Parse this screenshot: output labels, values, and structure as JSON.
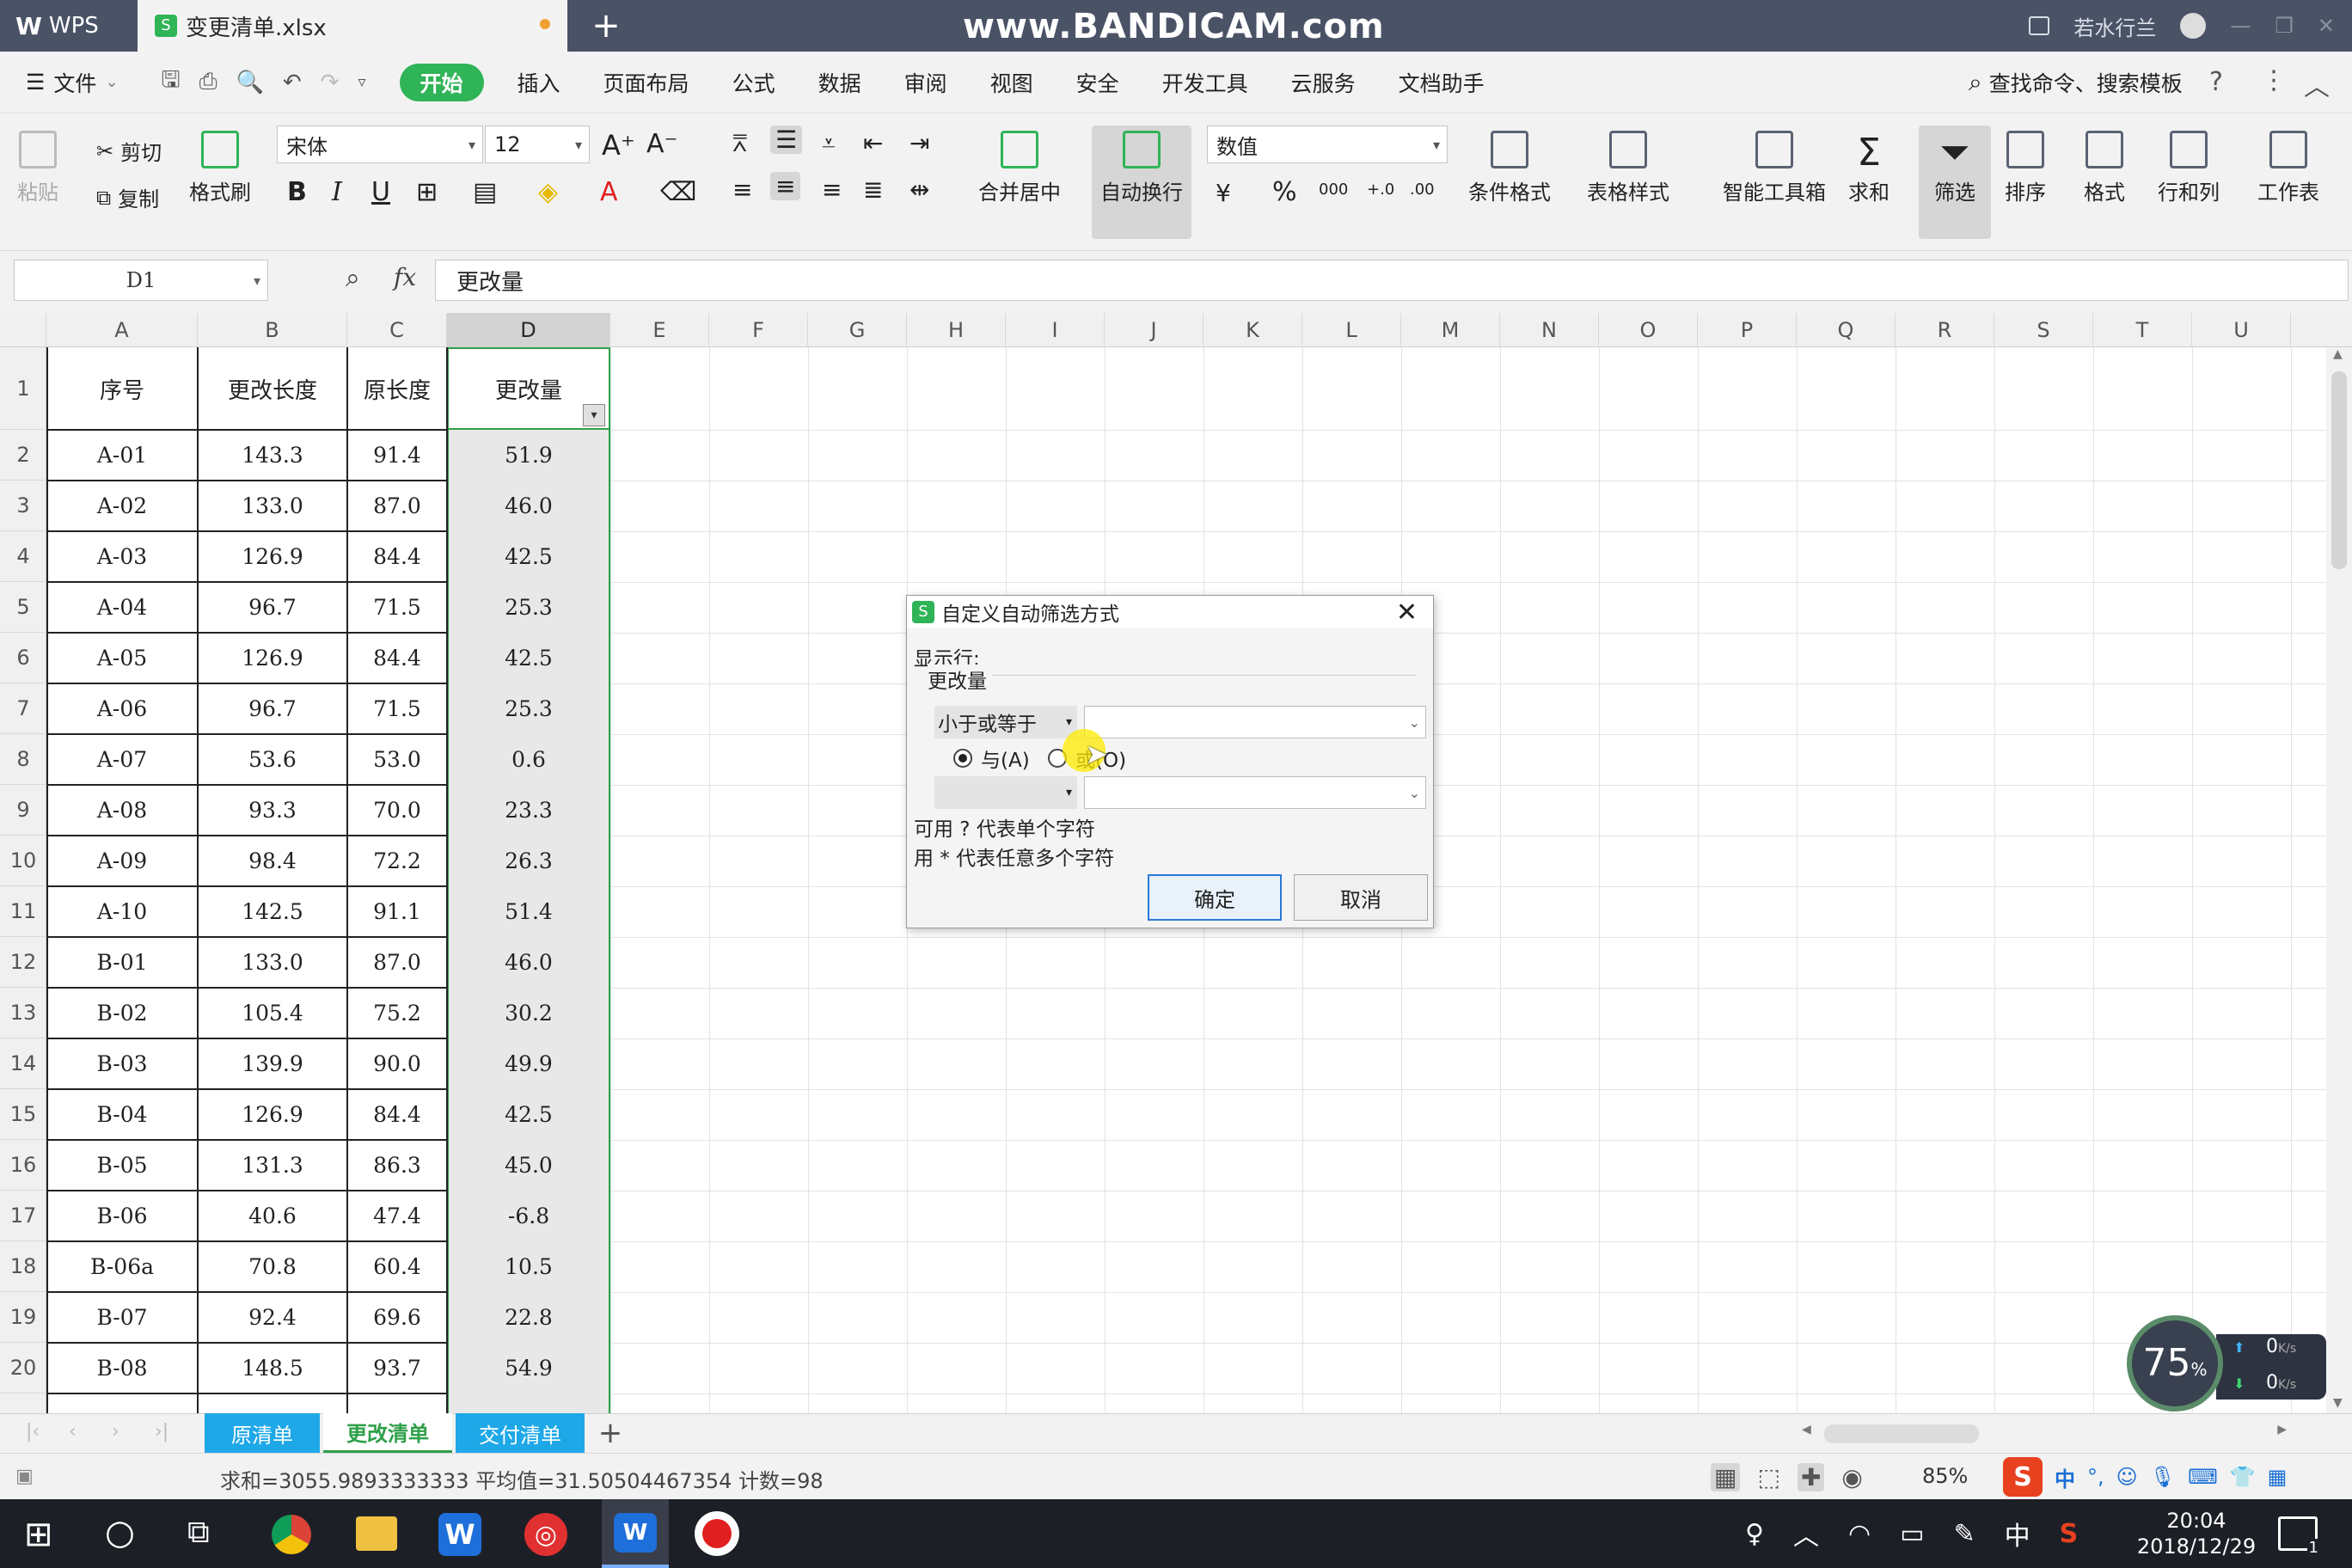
{
  "titlebar": {
    "app_name": "WPS",
    "file_tab": "变更清单.xlsx",
    "watermark": "www.BANDICAM.com",
    "user": "若水行兰"
  },
  "menu": {
    "file": "文件",
    "items": [
      "开始",
      "插入",
      "页面布局",
      "公式",
      "数据",
      "审阅",
      "视图",
      "安全",
      "开发工具",
      "云服务",
      "文档助手"
    ],
    "search": "查找命令、搜索模板"
  },
  "ribbon": {
    "paste": "粘贴",
    "cut": "剪切",
    "copy": "复制",
    "format_painter": "格式刷",
    "font_name": "宋体",
    "font_size": "12",
    "merge_center": "合并居中",
    "wrap_text": "自动换行",
    "number_format": "数值",
    "cond_format": "条件格式",
    "table_style": "表格样式",
    "smart_toolbox": "智能工具箱",
    "sum": "求和",
    "filter": "筛选",
    "sort": "排序",
    "format": "格式",
    "row_col": "行和列",
    "worksheet": "工作表",
    "bold": "B",
    "italic": "I",
    "underline": "U"
  },
  "formula_bar": {
    "cell_ref": "D1",
    "fx": "fx",
    "content": "更改量"
  },
  "columns": [
    "A",
    "B",
    "C",
    "D",
    "E",
    "F",
    "G",
    "H",
    "I",
    "J",
    "K",
    "L",
    "M",
    "N",
    "O",
    "P",
    "Q",
    "R",
    "S",
    "T",
    "U"
  ],
  "header_row": [
    "序号",
    "更改长度",
    "原长度",
    "更改量"
  ],
  "rows": [
    [
      "A-01",
      "143.3",
      "91.4",
      "51.9"
    ],
    [
      "A-02",
      "133.0",
      "87.0",
      "46.0"
    ],
    [
      "A-03",
      "126.9",
      "84.4",
      "42.5"
    ],
    [
      "A-04",
      "96.7",
      "71.5",
      "25.3"
    ],
    [
      "A-05",
      "126.9",
      "84.4",
      "42.5"
    ],
    [
      "A-06",
      "96.7",
      "71.5",
      "25.3"
    ],
    [
      "A-07",
      "53.6",
      "53.0",
      "0.6"
    ],
    [
      "A-08",
      "93.3",
      "70.0",
      "23.3"
    ],
    [
      "A-09",
      "98.4",
      "72.2",
      "26.3"
    ],
    [
      "A-10",
      "142.5",
      "91.1",
      "51.4"
    ],
    [
      "B-01",
      "133.0",
      "87.0",
      "46.0"
    ],
    [
      "B-02",
      "105.4",
      "75.2",
      "30.2"
    ],
    [
      "B-03",
      "139.9",
      "90.0",
      "49.9"
    ],
    [
      "B-04",
      "126.9",
      "84.4",
      "42.5"
    ],
    [
      "B-05",
      "131.3",
      "86.3",
      "45.0"
    ],
    [
      "B-06",
      "40.6",
      "47.4",
      "-6.8"
    ],
    [
      "B-06a",
      "70.8",
      "60.4",
      "10.5"
    ],
    [
      "B-07",
      "92.4",
      "69.6",
      "22.8"
    ],
    [
      "B-08",
      "148.5",
      "93.7",
      "54.9"
    ]
  ],
  "sheet_tabs": [
    "原清单",
    "更改清单",
    "交付清单"
  ],
  "status": {
    "summary": "求和=3055.9893333333  平均值=31.50504467354  计数=98",
    "zoom": "85%"
  },
  "dialog": {
    "title": "自定义自动筛选方式",
    "show_rows": "显示行:",
    "field": "更改量",
    "operator1": "小于或等于",
    "value1": "",
    "and_label": "与(A)",
    "or_label": "或(O)",
    "operator2": "",
    "value2": "",
    "hint1": "可用 ? 代表单个字符",
    "hint2": "用 * 代表任意多个字符",
    "ok": "确定",
    "cancel": "取消"
  },
  "overlay": {
    "percent": "75",
    "percent_unit": "%",
    "up": "0",
    "down": "0",
    "unit": "K/s"
  },
  "taskbar": {
    "time": "20:04",
    "date": "2018/12/29",
    "ime": "中",
    "notify_count": "1"
  }
}
